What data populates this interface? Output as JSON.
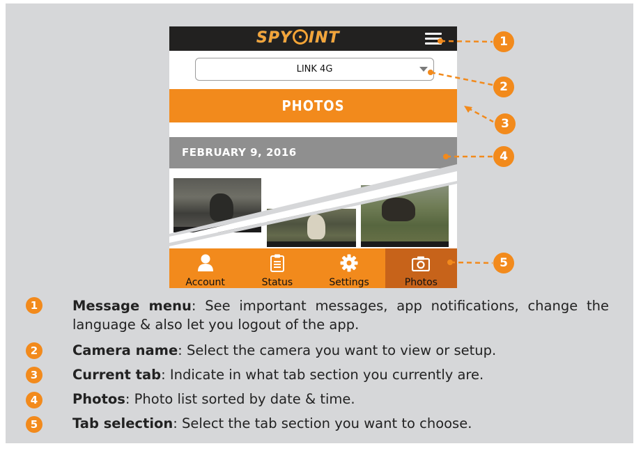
{
  "app": {
    "logo": "SPYPOINT",
    "camera_name": "LINK 4G",
    "current_tab_title": "PHOTOS",
    "date_header": "FEBRUARY 9, 2016"
  },
  "tabs": [
    {
      "label": "Account",
      "icon": "person-icon"
    },
    {
      "label": "Status",
      "icon": "clipboard-icon"
    },
    {
      "label": "Settings",
      "icon": "gear-icon"
    },
    {
      "label": "Photos",
      "icon": "camera-icon",
      "active": true
    }
  ],
  "callouts": [
    "1",
    "2",
    "3",
    "4",
    "5"
  ],
  "legend": [
    {
      "num": "1",
      "term": "Message menu",
      "desc": ": See important messages, app notifications, change the language & also let you logout of the app."
    },
    {
      "num": "2",
      "term": "Camera name",
      "desc": ":  Select the camera you want to view or setup."
    },
    {
      "num": "3",
      "term": "Current tab",
      "desc": ": Indicate in what tab section you currently are."
    },
    {
      "num": "4",
      "term": "Photos",
      "desc": ": Photo list sorted by date & time."
    },
    {
      "num": "5",
      "term": "Tab selection",
      "desc": ": Select the tab section you want to choose."
    }
  ],
  "colors": {
    "accent": "#f28a1c",
    "topbar": "#222120",
    "date_band": "#8f8f8f",
    "panel": "#d6d7d9",
    "active_tab": "#c7631a"
  }
}
